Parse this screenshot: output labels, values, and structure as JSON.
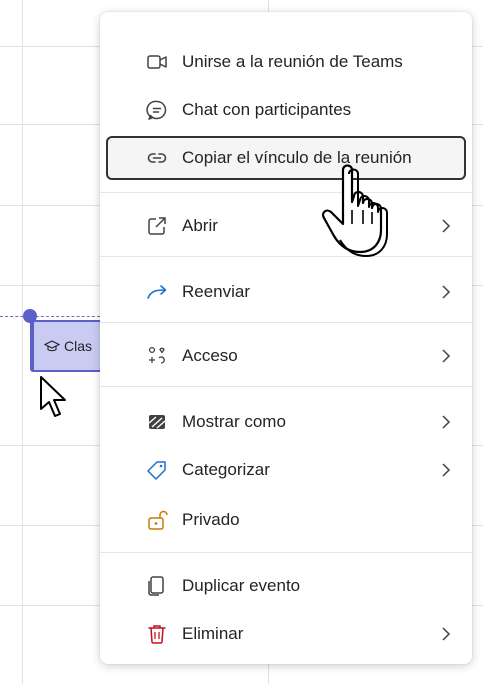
{
  "calendar": {
    "event_label": "Clas"
  },
  "menu": {
    "items": [
      {
        "label": "Unirse a la reunión de Teams",
        "icon": "video-icon"
      },
      {
        "label": "Chat con participantes",
        "icon": "chat-icon"
      },
      {
        "label": "Copiar el vínculo de la reunión",
        "icon": "link-icon"
      },
      {
        "label": "Abrir",
        "icon": "open-external-icon"
      },
      {
        "label": "Reenviar",
        "icon": "forward-arrow-icon"
      },
      {
        "label": "Acceso",
        "icon": "people-access-icon"
      },
      {
        "label": "Mostrar como",
        "icon": "show-as-icon"
      },
      {
        "label": "Categorizar",
        "icon": "tag-icon"
      },
      {
        "label": "Privado",
        "icon": "lock-icon"
      },
      {
        "label": "Duplicar evento",
        "icon": "duplicate-icon"
      },
      {
        "label": "Eliminar",
        "icon": "trash-icon"
      }
    ]
  },
  "colors": {
    "accent": "#5b5fc7",
    "event_fill": "#c9cbf2",
    "delete_red": "#c50f1f",
    "private_orange": "#c97a0a",
    "forward_blue": "#1f6fd1"
  }
}
